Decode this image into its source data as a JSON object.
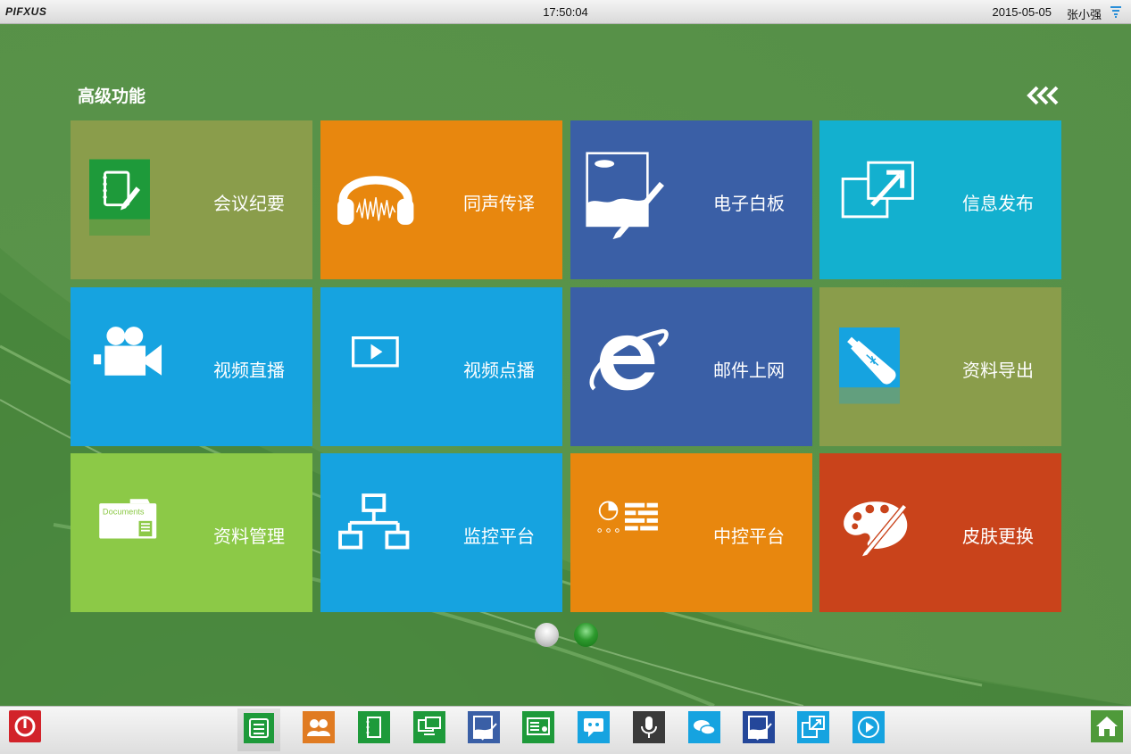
{
  "topbar": {
    "logo": "PIFXUS",
    "time": "17:50:04",
    "date": "2015-05-05",
    "user": "张小强",
    "filter_icon": "filter-icon"
  },
  "main": {
    "section_title": "高级功能",
    "tiles": [
      {
        "label": "会议纪要",
        "color": "#8a9d4b",
        "icon": "notebook-icon"
      },
      {
        "label": "同声传译",
        "color": "#e8870e",
        "icon": "headphones-icon"
      },
      {
        "label": "电子白板",
        "color": "#3a5fa6",
        "icon": "whiteboard-icon"
      },
      {
        "label": "信息发布",
        "color": "#13b0cf",
        "icon": "publish-icon"
      },
      {
        "label": "视频直播",
        "color": "#16a3e0",
        "icon": "video-camera-icon"
      },
      {
        "label": "视频点播",
        "color": "#16a3e0",
        "icon": "play-icon"
      },
      {
        "label": "邮件上网",
        "color": "#3a5fa6",
        "icon": "ie-browser-icon"
      },
      {
        "label": "资料导出",
        "color": "#8a9d4b",
        "icon": "usb-drive-icon"
      },
      {
        "label": "资料管理",
        "color": "#8cc947",
        "icon": "documents-folder-icon"
      },
      {
        "label": "监控平台",
        "color": "#16a3e0",
        "icon": "network-icon"
      },
      {
        "label": "中控平台",
        "color": "#e8870e",
        "icon": "control-panel-icon"
      },
      {
        "label": "皮肤更换",
        "color": "#c9431b",
        "icon": "palette-icon"
      }
    ],
    "documents_icon_text": "Documents",
    "page_indicator": {
      "pages": 2,
      "current": 2
    }
  },
  "dock": {
    "items": [
      {
        "icon": "power-icon",
        "color": "#d2232a"
      },
      {
        "icon": "agenda-icon",
        "color": "#1e9a3a"
      },
      {
        "icon": "attendees-icon",
        "color": "#e07b22"
      },
      {
        "icon": "notebook-icon",
        "color": "#1e9a3a"
      },
      {
        "icon": "screen-share-icon",
        "color": "#1e9a3a"
      },
      {
        "icon": "whiteboard-icon",
        "color": "#3a5fa6"
      },
      {
        "icon": "presentation-icon",
        "color": "#1e9a3a"
      },
      {
        "icon": "chat-icon",
        "color": "#16a3e0"
      },
      {
        "icon": "microphone-icon",
        "color": "#3a3a3a"
      },
      {
        "icon": "message-icon",
        "color": "#16a3e0"
      },
      {
        "icon": "annotation-icon",
        "color": "#24479a"
      },
      {
        "icon": "external-window-icon",
        "color": "#16a3e0"
      },
      {
        "icon": "play-icon",
        "color": "#16a3e0"
      },
      {
        "icon": "home-icon",
        "color": "#4f9a3a"
      }
    ]
  }
}
